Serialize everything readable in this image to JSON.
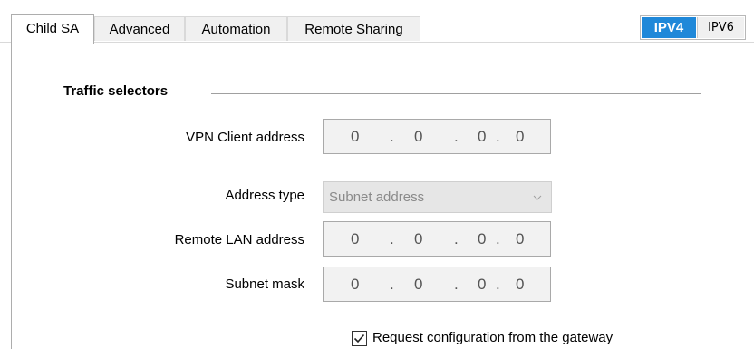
{
  "tabs": [
    "Child SA",
    "Advanced",
    "Automation",
    "Remote Sharing"
  ],
  "ip_version": {
    "v4": "IPV4",
    "v6": "IPV6",
    "selected": "IPV4"
  },
  "section": {
    "title": "Traffic selectors"
  },
  "fields": {
    "vpn_client_address": {
      "label": "VPN Client address",
      "octets": [
        "0",
        "0",
        "0",
        "0"
      ]
    },
    "address_type": {
      "label": "Address type",
      "value": "Subnet address"
    },
    "remote_lan_address": {
      "label": "Remote LAN address",
      "octets": [
        "0",
        "0",
        "0",
        "0"
      ]
    },
    "subnet_mask": {
      "label": "Subnet mask",
      "octets": [
        "0",
        "0",
        "0",
        "0"
      ]
    }
  },
  "request_config": {
    "label": "Request configuration from the gateway",
    "checked": true
  },
  "ip_separator": ".",
  "colors": {
    "accent": "#1f88d9",
    "disabled_bg": "#e6e6e6"
  }
}
